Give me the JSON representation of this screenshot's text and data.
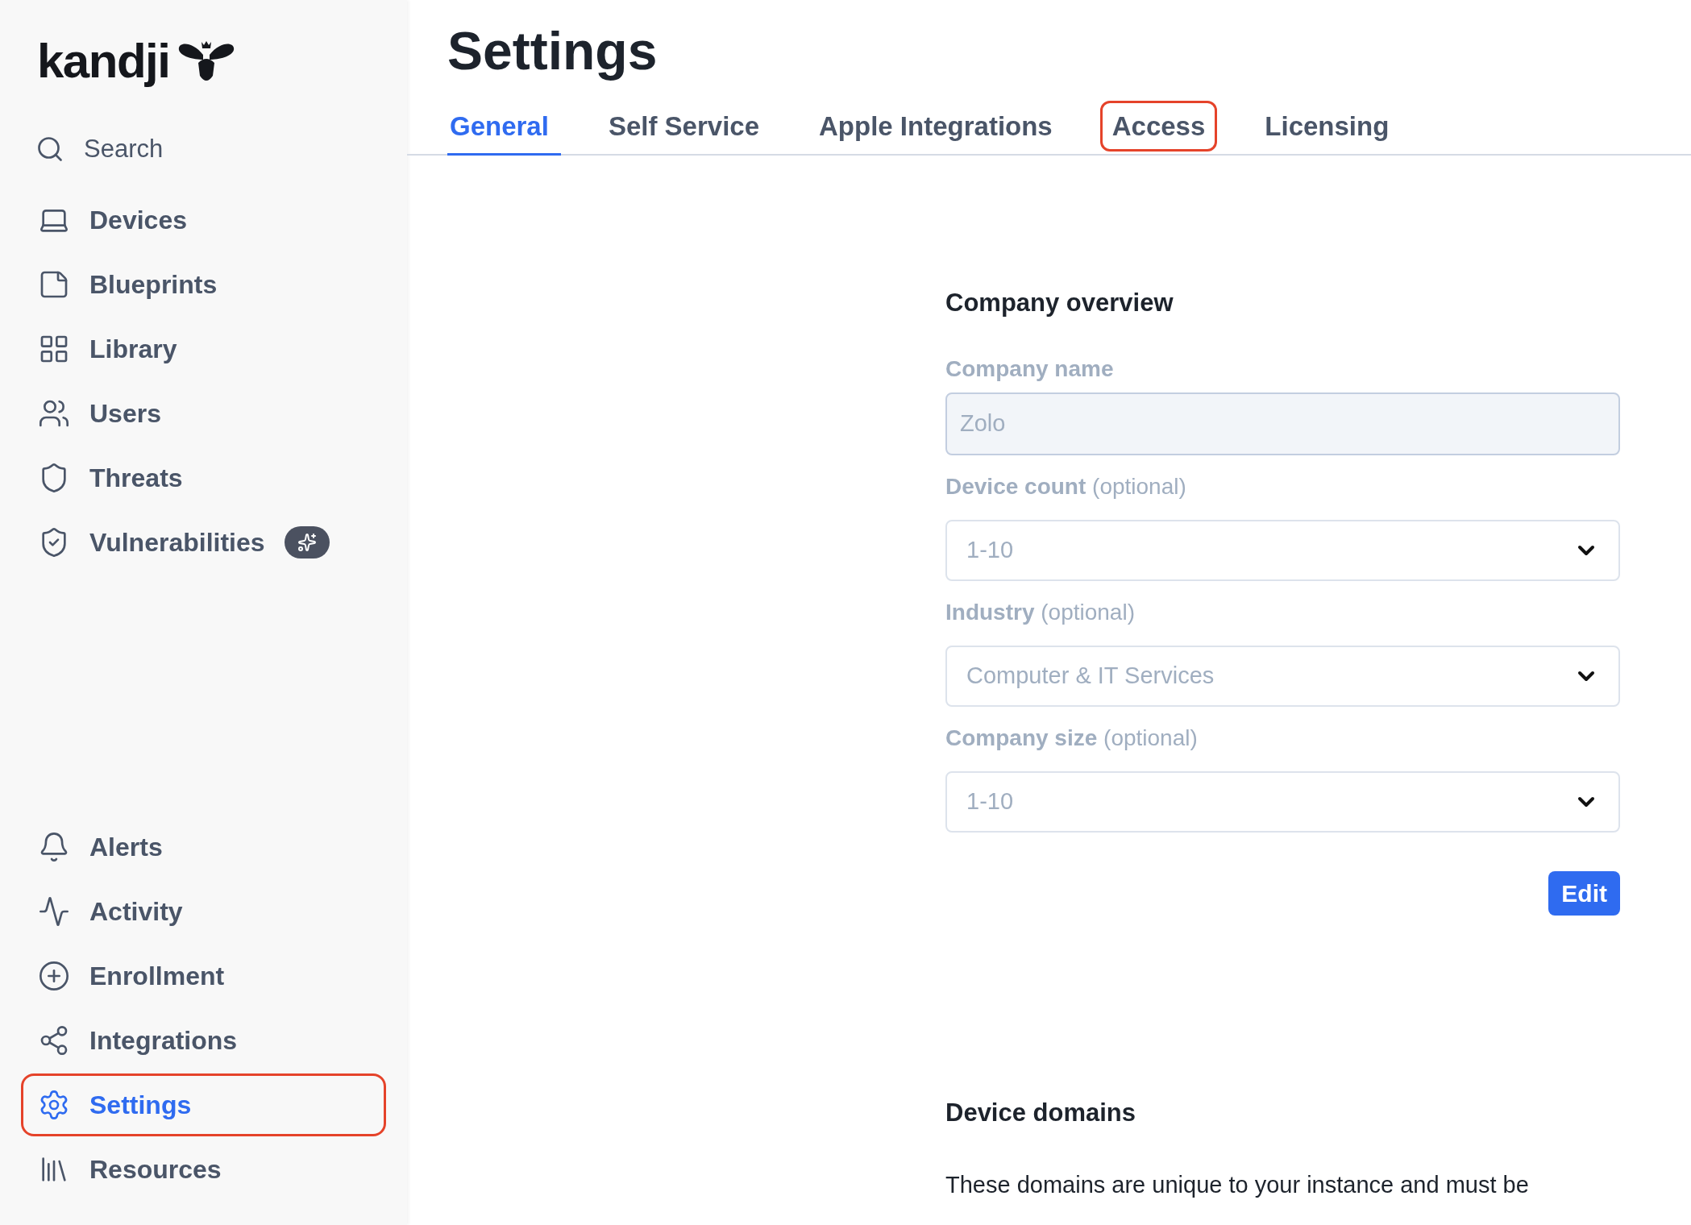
{
  "logo": {
    "text": "kandji"
  },
  "search": {
    "label": "Search"
  },
  "nav_top": [
    {
      "label": "Devices",
      "selected": false,
      "highlighted": false,
      "badge": false
    },
    {
      "label": "Blueprints",
      "selected": false,
      "highlighted": false,
      "badge": false
    },
    {
      "label": "Library",
      "selected": false,
      "highlighted": false,
      "badge": false
    },
    {
      "label": "Users",
      "selected": false,
      "highlighted": false,
      "badge": false
    },
    {
      "label": "Threats",
      "selected": false,
      "highlighted": false,
      "badge": false
    },
    {
      "label": "Vulnerabilities",
      "selected": false,
      "highlighted": false,
      "badge": true
    }
  ],
  "nav_bottom": [
    {
      "label": "Alerts",
      "selected": false,
      "highlighted": false,
      "badge": false
    },
    {
      "label": "Activity",
      "selected": false,
      "highlighted": false,
      "badge": false
    },
    {
      "label": "Enrollment",
      "selected": false,
      "highlighted": false,
      "badge": false
    },
    {
      "label": "Integrations",
      "selected": false,
      "highlighted": false,
      "badge": false
    },
    {
      "label": "Settings",
      "selected": true,
      "highlighted": true,
      "badge": false
    },
    {
      "label": "Resources",
      "selected": false,
      "highlighted": false,
      "badge": false
    }
  ],
  "page_title": "Settings",
  "tabs": [
    {
      "label": "General",
      "selected": true,
      "highlighted": false
    },
    {
      "label": "Self Service",
      "selected": false,
      "highlighted": false
    },
    {
      "label": "Apple Integrations",
      "selected": false,
      "highlighted": false
    },
    {
      "label": "Access",
      "selected": false,
      "highlighted": true
    },
    {
      "label": "Licensing",
      "selected": false,
      "highlighted": false
    }
  ],
  "company_overview": {
    "heading": "Company overview",
    "fields": [
      {
        "kind": "text",
        "label": "Company name",
        "value": "Zolo"
      },
      {
        "kind": "select",
        "label": "Device count",
        "hint": "(optional)",
        "value": "1-10"
      },
      {
        "kind": "select",
        "label": "Industry",
        "hint": "(optional)",
        "value": "Computer & IT Services"
      },
      {
        "kind": "select",
        "label": "Company size",
        "hint": "(optional)",
        "value": "1-10"
      }
    ],
    "button": "Edit"
  },
  "device_domains": {
    "heading": "Device domains",
    "text": "These domains are unique to your instance and must be"
  }
}
